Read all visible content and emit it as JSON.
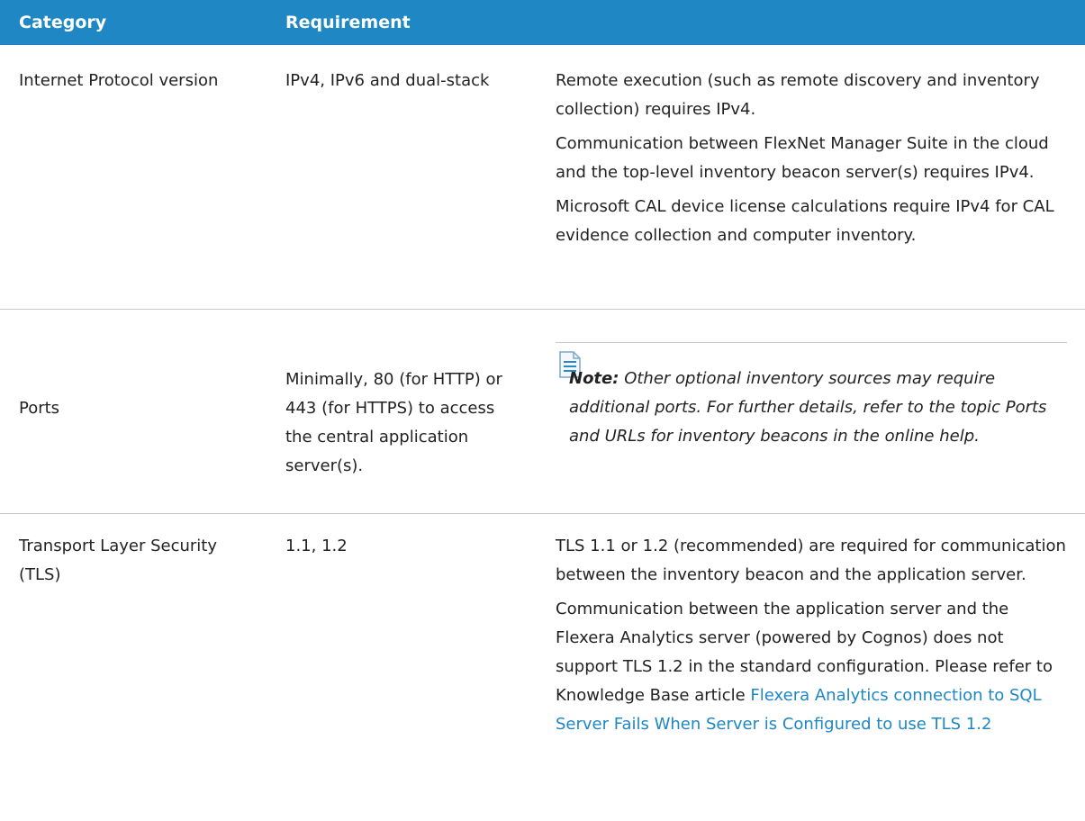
{
  "header": {
    "category": "Category",
    "requirement": "Requirement"
  },
  "rows": [
    {
      "category": "Internet Protocol version",
      "requirement": "IPv4, IPv6 and dual-stack",
      "notes": [
        "Remote execution (such as remote discovery and inventory collection) requires IPv4.",
        "Communication between FlexNet Manager Suite in the cloud and the top-level inventory beacon server(s) requires IPv4.",
        "Microsoft CAL device license calculations require IPv4 for CAL evidence collection and computer inventory."
      ]
    },
    {
      "category": "Ports",
      "requirement": "Minimally, 80 (for HTTP) or 443 (for HTTPS) to access the central application server(s).",
      "note_label": "Note:",
      "note_text": "Other optional inventory sources may require additional ports. For further details, refer to the topic Ports and URLs for inventory beacons in the online help."
    },
    {
      "category": "Transport Layer Security (TLS)",
      "requirement": "1.1, 1.2",
      "notes": [
        "TLS 1.1 or 1.2 (recommended) are required for communication between the inventory beacon and the application server.",
        "Communication between the application server and the Flexera Analytics server (powered by Cognos) does not support TLS 1.2 in the standard configuration. Please refer to Knowledge Base article"
      ],
      "link_text": "Flexera Analytics connection to SQL Server Fails When Server is Configured to use TLS 1.2"
    }
  ],
  "colors": {
    "header_bg": "#1e87c4",
    "link": "#1e87c4",
    "divider": "#c8c8c8"
  }
}
